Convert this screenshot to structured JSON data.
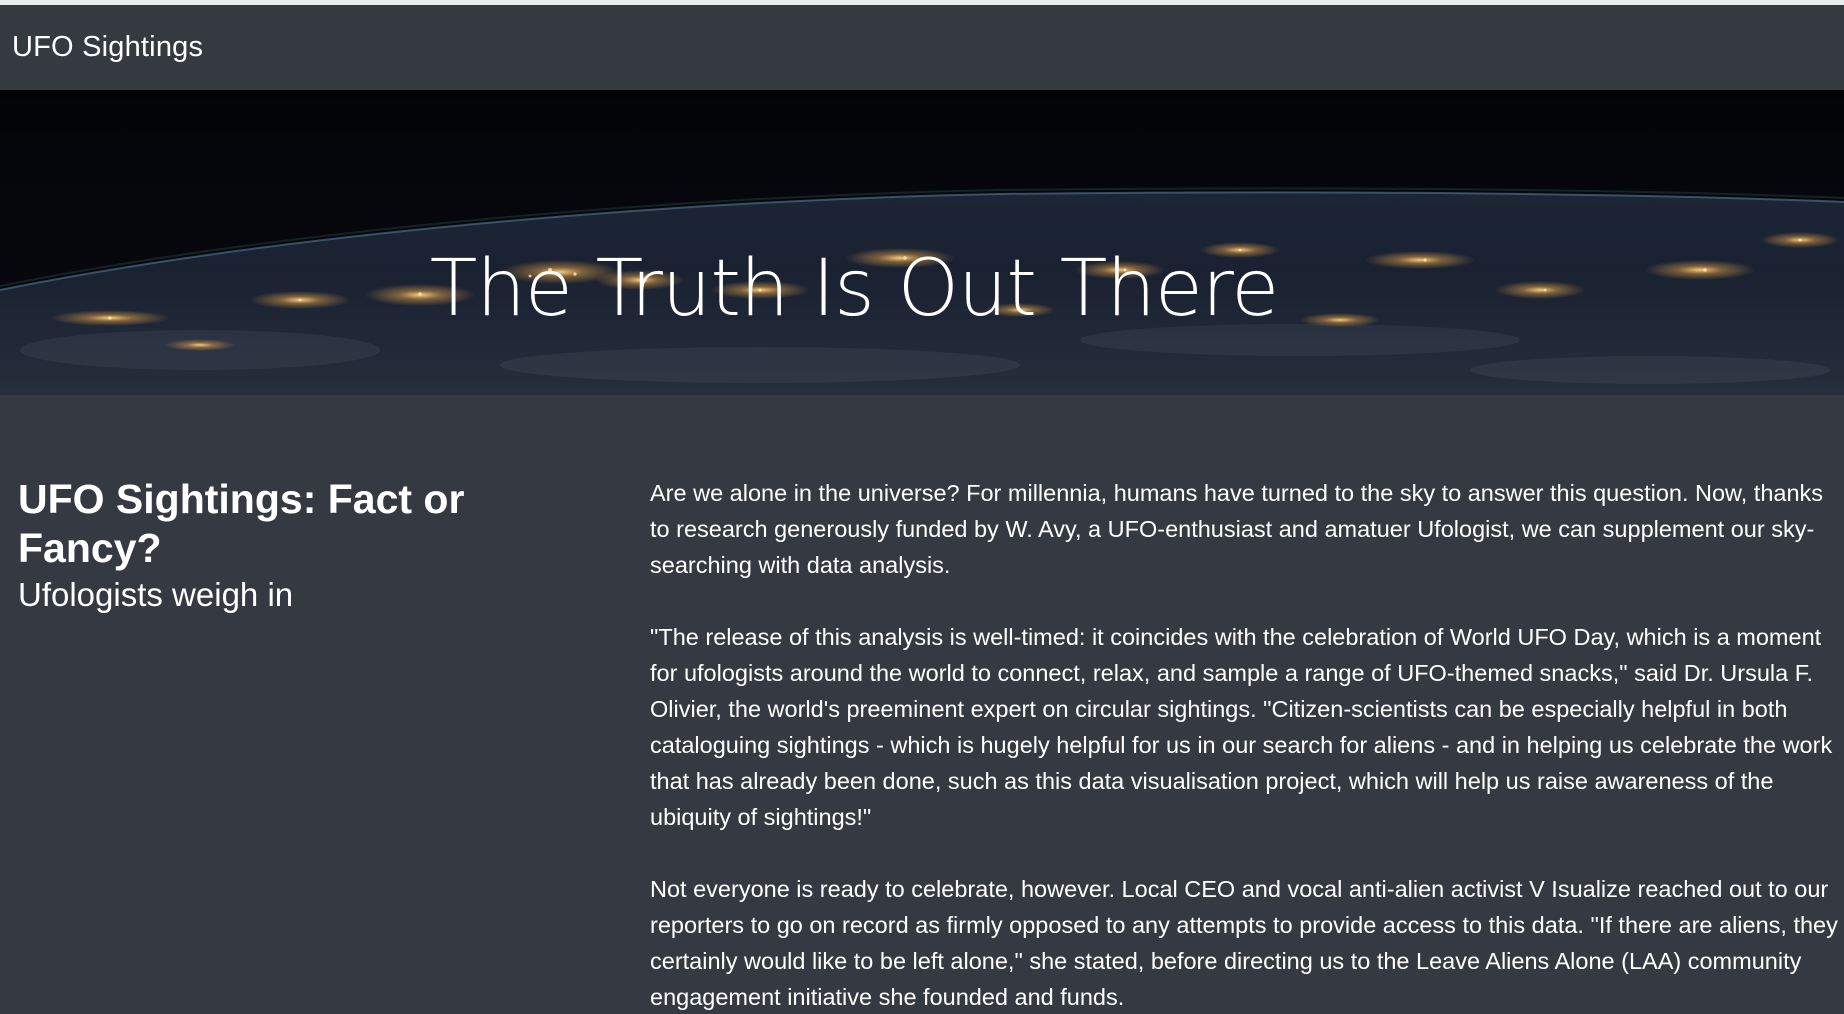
{
  "navbar": {
    "brand": "UFO Sightings"
  },
  "hero": {
    "title": "The Truth Is Out There"
  },
  "article": {
    "title": "UFO Sightings: Fact or Fancy?",
    "subtitle": "Ufologists weigh in",
    "paragraphs": [
      "Are we alone in the universe? For millennia, humans have turned to the sky to answer this question. Now, thanks to research generously funded by W. Avy, a UFO-enthusiast and amatuer Ufologist, we can supplement our sky-searching with data analysis.",
      "\"The release of this analysis is well-timed: it coincides with the celebration of World UFO Day, which is a moment for ufologists around the world to connect, relax, and sample a range of UFO-themed snacks,\" said Dr. Ursula F. Olivier, the world's preeminent expert on circular sightings. \"Citizen-scientists can be especially helpful in both cataloguing sightings - which is hugely helpful for us in our search for aliens - and in helping us celebrate the work that has already been done, such as this data visualisation project, which will help us raise awareness of the ubiquity of sightings!\"",
      "Not everyone is ready to celebrate, however. Local CEO and vocal anti-alien activist V Isualize reached out to our reporters to go on record as firmly opposed to any attempts to provide access to this data. \"If there are aliens, they certainly would like to be left alone,\" she stated, before directing us to the Leave Aliens Alone (LAA) community engagement initiative she founded and funds."
    ]
  }
}
